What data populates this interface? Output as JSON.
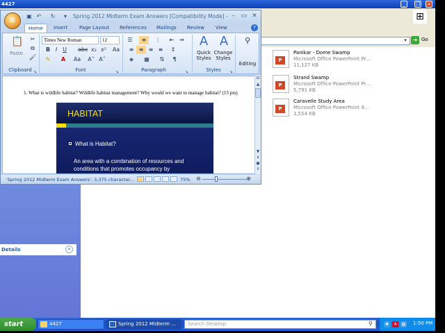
{
  "explorer": {
    "title": "4427",
    "address_go": "Go",
    "details_label": "Details",
    "files": [
      {
        "name": "Panikar - Dome Swamp",
        "type": "Microsoft Office PowerPoint Pr...",
        "size": "11,127 KB"
      },
      {
        "name": "Strand Swamp",
        "type": "Microsoft Office PowerPoint Pr...",
        "size": "5,791 KB"
      },
      {
        "name": "Caravelle Study Area",
        "type": "Microsoft Office PowerPoint 9...",
        "size": "1,554 KB"
      }
    ]
  },
  "word": {
    "title": "Spring 2012 Midterm Exam Answers [Compatibility Mode] - M",
    "tabs": [
      "Home",
      "Insert",
      "Page Layout",
      "References",
      "Mailings",
      "Review",
      "View"
    ],
    "ribbon": {
      "clipboard_label": "Clipboard",
      "paste_label": "Paste",
      "font_label": "Font",
      "font_name": "Times New Roman",
      "font_size": "12",
      "paragraph_label": "Paragraph",
      "styles_label": "Styles",
      "quick_styles": "Quick Styles",
      "change_styles": "Change Styles",
      "editing": "Editing"
    },
    "document": {
      "question": "1.   What is wildlife habitat?  Wildlife habitat management?  Why would we want to manage habitat? (15 pts)",
      "slide_title": "HABITAT",
      "slide_bullet": "What is Habitat?",
      "slide_body": "An area with a combination of resources and conditions that promotes occupancy by"
    },
    "status": {
      "text": "'Spring 2012 Midterm Exam Answers': 3,375 character...",
      "zoom": "75%"
    }
  },
  "taskbar": {
    "start": "start",
    "tasks": [
      "4427",
      "Spring 2012 Midterm ..."
    ],
    "search_placeholder": "Search Desktop",
    "clock": "1:50 PM"
  },
  "colors": {
    "xp_blue": "#245EDB",
    "start_green": "#3C9A39",
    "slide_title_yellow": "#F8E10A",
    "slide_bg_navy": "#15226A"
  }
}
